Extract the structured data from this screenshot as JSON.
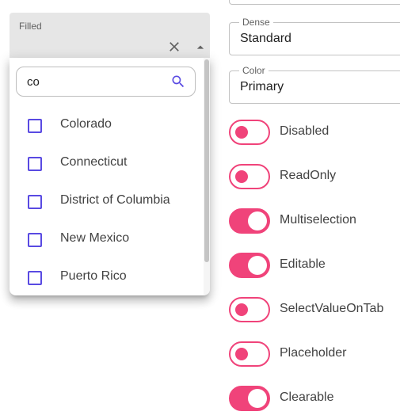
{
  "filled_select": {
    "label": "Filled",
    "clear_icon": "close-icon",
    "arrow_icon": "arrow-drop-up-icon"
  },
  "popover": {
    "search": {
      "value": "co",
      "icon": "search-icon"
    },
    "options": [
      {
        "label": "Colorado",
        "checked": false
      },
      {
        "label": "Connecticut",
        "checked": false
      },
      {
        "label": "District of Columbia",
        "checked": false
      },
      {
        "label": "New Mexico",
        "checked": false
      },
      {
        "label": "Puerto Rico",
        "checked": false
      }
    ]
  },
  "dense_select": {
    "label": "Dense",
    "value": "Standard"
  },
  "color_select": {
    "label": "Color",
    "value": "Primary"
  },
  "switches": [
    {
      "label": "Disabled",
      "on": false
    },
    {
      "label": "ReadOnly",
      "on": false
    },
    {
      "label": "Multiselection",
      "on": true
    },
    {
      "label": "Editable",
      "on": true
    },
    {
      "label": "SelectValueOnTab",
      "on": false
    },
    {
      "label": "Placeholder",
      "on": false
    },
    {
      "label": "Clearable",
      "on": true
    }
  ],
  "colors": {
    "accent": "#f0437a",
    "primary": "#594ae2"
  }
}
